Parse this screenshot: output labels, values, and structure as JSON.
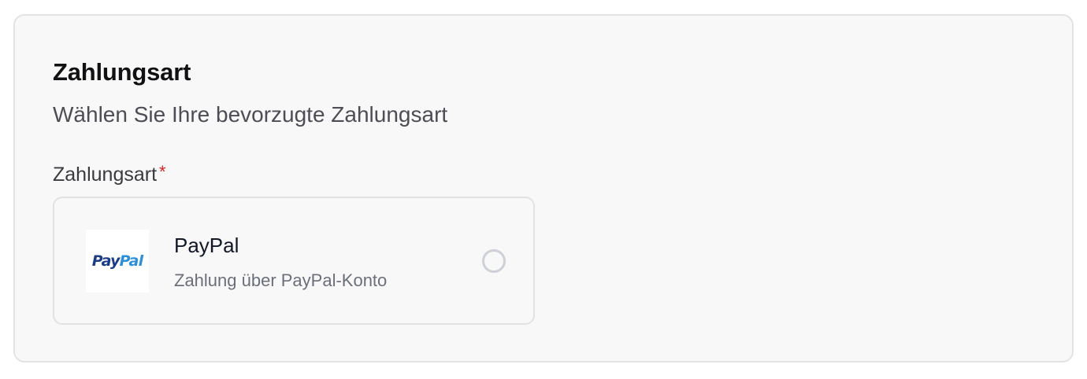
{
  "payment_section": {
    "title": "Zahlungsart",
    "subtitle": "Wählen Sie Ihre bevorzugte Zahlungsart",
    "field_label": "Zahlungsart",
    "required_marker": "*",
    "options": [
      {
        "logo_icon": "paypal-logo-icon",
        "logo_text_part1": "Pay",
        "logo_text_part2": "Pal",
        "title": "PayPal",
        "description": "Zahlung über PayPal-Konto",
        "selected": false
      }
    ]
  },
  "colors": {
    "required": "#e02424",
    "paypal_dark_blue": "#1b3c86",
    "paypal_light_blue": "#2d8fd8",
    "card_background": "#f8f8f8",
    "border": "#e3e3e5"
  }
}
